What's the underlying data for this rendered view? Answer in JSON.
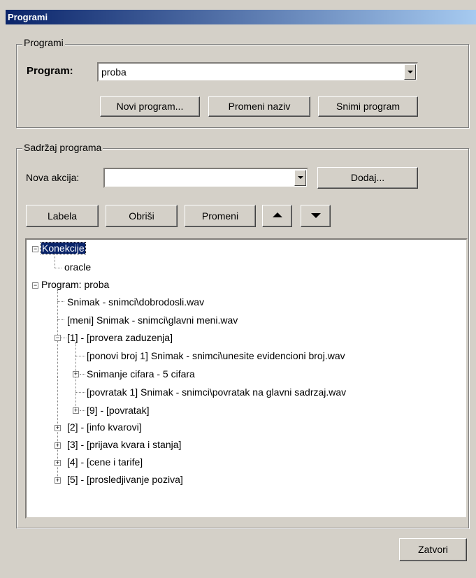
{
  "window": {
    "title": "Programi"
  },
  "programi_group": {
    "legend": "Programi",
    "program_label": "Program:",
    "program_value": "proba",
    "buttons": {
      "novi": "Novi program...",
      "promeni_naziv": "Promeni naziv",
      "snimi": "Snimi program"
    }
  },
  "sadrzaj_group": {
    "legend": "Sadržaj programa",
    "nova_akcija_label": "Nova akcija:",
    "nova_akcija_value": "",
    "dodaj": "Dodaj...",
    "labela": "Labela",
    "obrisi": "Obriši",
    "promeni": "Promeni"
  },
  "tree": {
    "konekcije": "Konekcije",
    "oracle": "oracle",
    "program": "Program: proba",
    "snimak1": "Snimak - snimci\\dobrodosli.wav",
    "meni": "[meni]  Snimak - snimci\\glavni meni.wav",
    "n1": "[1] - [provera zaduzenja]",
    "ponovi": "[ponovi broj 1]  Snimak - snimci\\unesite evidencioni broj.wav",
    "snimanje": "Snimanje cifara - 5 cifara",
    "povratak": "[povratak 1]  Snimak - snimci\\povratak na glavni sadrzaj.wav",
    "n9": "[9] - [povratak]",
    "n2": "[2] - [info kvarovi]",
    "n3": "[3] - [prijava kvara i stanja]",
    "n4": "[4] - [cene i tarife]",
    "n5": "[5] - [prosledjivanje poziva]"
  },
  "zatvori": "Zatvori"
}
